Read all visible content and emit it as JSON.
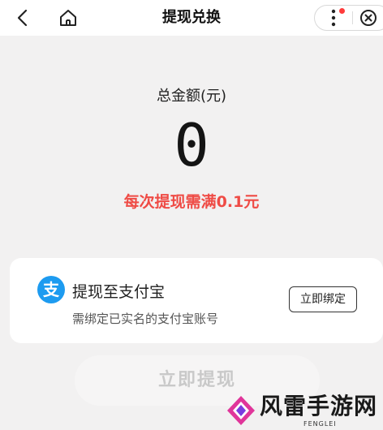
{
  "header": {
    "title": "提现兑换",
    "back_icon": "back-arrow-icon",
    "home_icon": "home-icon",
    "more_icon": "more-dots-icon",
    "close_icon": "close-circle-icon"
  },
  "amount": {
    "label": "总金额(元)",
    "value": "0",
    "rule": "每次提现需满0.1元"
  },
  "alipay_card": {
    "icon_glyph": "支",
    "title": "提现至支付宝",
    "subtitle": "需绑定已实名的支付宝账号",
    "bind_label": "立即绑定"
  },
  "withdraw_button": {
    "label": "立即提现"
  },
  "watermark": {
    "text": "风雷手游网",
    "subtext": "FENGLEI"
  },
  "colors": {
    "accent_red": "#ef4b45",
    "alipay_blue": "#1d9bf0",
    "background": "#f2f1f1",
    "notification_dot": "#ff3b3b"
  }
}
